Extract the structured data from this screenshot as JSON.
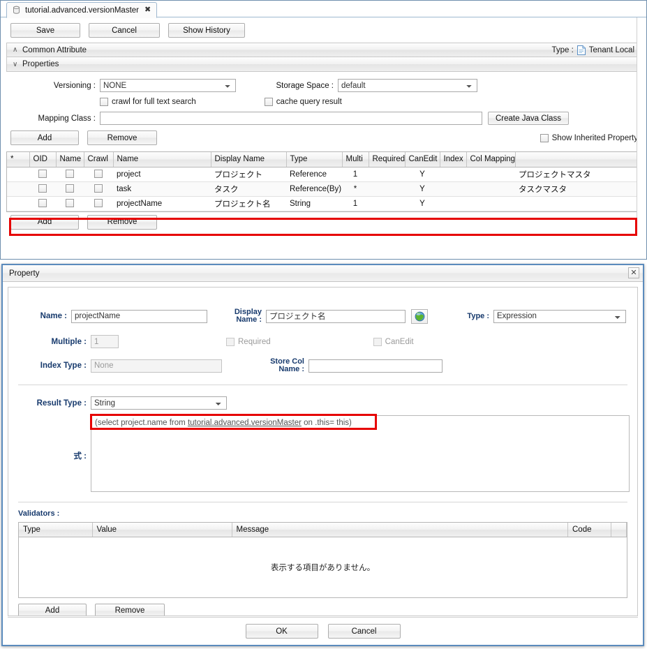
{
  "editor": {
    "tab": {
      "label": "tutorial.advanced.versionMaster",
      "icon": "database-icon",
      "close": "✖"
    },
    "toolbar": {
      "save": "Save",
      "cancel": "Cancel",
      "show_history": "Show History"
    },
    "sections": {
      "common_attribute": {
        "label": "Common Attribute",
        "chevron": "∧"
      },
      "properties": {
        "label": "Properties",
        "chevron": "∨"
      },
      "type_label": "Type :",
      "type_value": "Tenant Local"
    },
    "form": {
      "versioning_label": "Versioning :",
      "versioning_value": "NONE",
      "storage_space_label": "Storage Space :",
      "storage_space_value": "default",
      "crawl_label": "crawl for full text search",
      "cache_label": "cache query result",
      "mapping_class_label": "Mapping Class :",
      "mapping_class_value": "",
      "create_java_class": "Create Java Class",
      "show_inherited_property": "Show Inherited Property"
    },
    "grid_buttons": {
      "add": "Add",
      "remove": "Remove"
    },
    "grid": {
      "headers": [
        "*",
        "OID",
        "Name",
        "Crawl",
        "Name",
        "Display Name",
        "Type",
        "Multi",
        "Required",
        "CanEdit",
        "Index",
        "Col Mapping",
        ""
      ],
      "rows": [
        {
          "star": "",
          "oid": "",
          "name_chk": "",
          "crawl": "",
          "name": "project",
          "display_name": "プロジェクト",
          "type": "Reference",
          "multi": "1",
          "required": "",
          "canedit": "Y",
          "index": "",
          "col_mapping": "",
          "extra": "プロジェクトマスタ",
          "highlighted": false
        },
        {
          "star": "",
          "oid": "",
          "name_chk": "",
          "crawl": "",
          "name": "task",
          "display_name": "タスク",
          "type": "Reference(By)",
          "multi": "*",
          "required": "",
          "canedit": "Y",
          "index": "",
          "col_mapping": "",
          "extra": "タスクマスタ",
          "highlighted": false
        },
        {
          "star": "",
          "oid": "",
          "name_chk": "",
          "crawl": "",
          "name": "projectName",
          "display_name": "プロジェクト名",
          "type": "String",
          "multi": "1",
          "required": "",
          "canedit": "Y",
          "index": "",
          "col_mapping": "",
          "extra": "",
          "highlighted": true
        }
      ]
    },
    "grid_buttons_bottom": {
      "add": "Add",
      "remove": "Remove"
    }
  },
  "dialog": {
    "title": "Property",
    "close": "✕",
    "fields": {
      "name_label": "Name :",
      "name_value": "projectName",
      "display_name_label_1": "Display",
      "display_name_label_2": "Name :",
      "display_name_value": "プロジェクト名",
      "globe_icon": "globe-icon",
      "type_label": "Type :",
      "type_value": "Expression",
      "multiple_label": "Multiple :",
      "multiple_value": "1",
      "required_label": "Required",
      "canedit_label": "CanEdit",
      "index_type_label": "Index Type :",
      "index_type_value": "None",
      "store_col_label_1": "Store Col",
      "store_col_label_2": "Name :",
      "store_col_value": "",
      "result_type_label": "Result Type :",
      "result_type_value": "String",
      "expression_label": "式 :",
      "expression_value": "(select project.name from tutorial.advanced.versionMaster on .this= this)",
      "expression_link_text": "tutorial.advanced.versionMaster"
    },
    "validators": {
      "label": "Validators :",
      "headers": [
        "Type",
        "Value",
        "Message",
        "Code",
        ""
      ],
      "empty_message": "表示する項目がありません。",
      "add": "Add",
      "remove": "Remove"
    },
    "footer": {
      "ok": "OK",
      "cancel": "Cancel"
    }
  },
  "colors": {
    "highlight": "#e60000",
    "dialog_border": "#5b8bbd",
    "label_blue": "#173a6d"
  }
}
